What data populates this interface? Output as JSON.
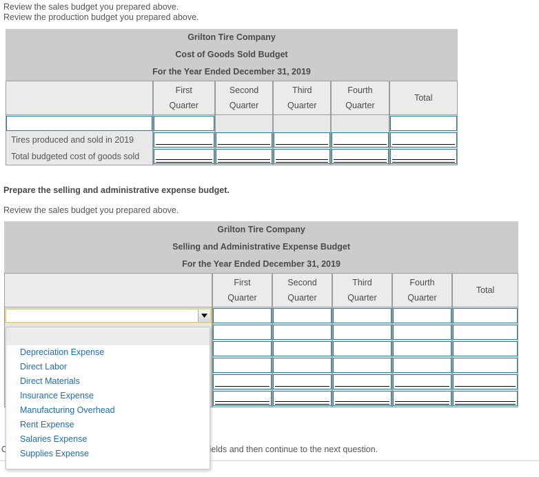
{
  "instructions": {
    "line1": "Review the sales budget you prepared above.",
    "line2": "Review the production budget you prepared above.",
    "line3": "Prepare the selling and administrative expense budget.",
    "line4": "Review the sales budget you prepared above.",
    "footer": "Choose from any list or enter any number in the input fields and then continue to the next question."
  },
  "colors": {
    "title_band": "#cccccc",
    "column_header": "#ebebeb",
    "cell_background": "#e8e8e8",
    "input_cell_background": "#ddeef6",
    "input_border": "#2a7a93",
    "select_border": "#e8d271",
    "option_text": "#1f6cb0"
  },
  "table_cogs": {
    "title_line1": "Grilton Tire Company",
    "title_line2": "Cost of Goods Sold Budget",
    "title_line3": "For the Year Ended December 31, 2019",
    "columns": [
      {
        "top": "",
        "bottom": ""
      },
      {
        "top": "First",
        "bottom": "Quarter"
      },
      {
        "top": "Second",
        "bottom": "Quarter"
      },
      {
        "top": "Third",
        "bottom": "Quarter"
      },
      {
        "top": "Fourth",
        "bottom": "Quarter"
      },
      {
        "top": "",
        "bottom": "Total"
      }
    ],
    "rows": [
      {
        "label": "",
        "label_is_input": true,
        "label_value": "",
        "cells": [
          {
            "type": "input",
            "value": "",
            "rule": "none"
          },
          {
            "type": "empty",
            "value": "",
            "rule": "none"
          },
          {
            "type": "empty",
            "value": "",
            "rule": "none"
          },
          {
            "type": "empty",
            "value": "",
            "rule": "none"
          },
          {
            "type": "input",
            "value": "",
            "rule": "none"
          }
        ]
      },
      {
        "label": "Tires produced and sold in 2019",
        "label_is_input": false,
        "label_value": "",
        "cells": [
          {
            "type": "input",
            "value": "",
            "rule": "single"
          },
          {
            "type": "input",
            "value": "",
            "rule": "single"
          },
          {
            "type": "input",
            "value": "",
            "rule": "single"
          },
          {
            "type": "input",
            "value": "",
            "rule": "single"
          },
          {
            "type": "input",
            "value": "",
            "rule": "single"
          }
        ]
      },
      {
        "label": "Total budgeted cost of goods sold",
        "label_is_input": false,
        "label_value": "",
        "cells": [
          {
            "type": "input",
            "value": "",
            "rule": "double"
          },
          {
            "type": "input",
            "value": "",
            "rule": "double"
          },
          {
            "type": "input",
            "value": "",
            "rule": "double"
          },
          {
            "type": "input",
            "value": "",
            "rule": "double"
          },
          {
            "type": "input",
            "value": "",
            "rule": "double"
          }
        ]
      }
    ]
  },
  "table_sae": {
    "title_line1": "Grilton Tire Company",
    "title_line2": "Selling and Administrative Expense Budget",
    "title_line3": "For the Year Ended December 31, 2019",
    "columns": [
      {
        "top": "",
        "bottom": ""
      },
      {
        "top": "First",
        "bottom": "Quarter"
      },
      {
        "top": "Second",
        "bottom": "Quarter"
      },
      {
        "top": "Third",
        "bottom": "Quarter"
      },
      {
        "top": "Fourth",
        "bottom": "Quarter"
      },
      {
        "top": "",
        "bottom": "Total"
      }
    ],
    "rows": [
      {
        "label": "",
        "label_is_select": true,
        "select_value": "",
        "cells": [
          {
            "type": "input",
            "value": "",
            "rule": "none"
          },
          {
            "type": "input",
            "value": "",
            "rule": "none"
          },
          {
            "type": "input",
            "value": "",
            "rule": "none"
          },
          {
            "type": "input",
            "value": "",
            "rule": "none"
          },
          {
            "type": "input",
            "value": "",
            "rule": "none"
          }
        ]
      },
      {
        "label": "",
        "label_is_select": false,
        "cells": [
          {
            "type": "input",
            "value": "",
            "rule": "none"
          },
          {
            "type": "input",
            "value": "",
            "rule": "none"
          },
          {
            "type": "input",
            "value": "",
            "rule": "none"
          },
          {
            "type": "input",
            "value": "",
            "rule": "none"
          },
          {
            "type": "input",
            "value": "",
            "rule": "none"
          }
        ]
      },
      {
        "label": "",
        "label_is_select": false,
        "cells": [
          {
            "type": "input",
            "value": "",
            "rule": "none"
          },
          {
            "type": "input",
            "value": "",
            "rule": "none"
          },
          {
            "type": "input",
            "value": "",
            "rule": "none"
          },
          {
            "type": "input",
            "value": "",
            "rule": "none"
          },
          {
            "type": "input",
            "value": "",
            "rule": "none"
          }
        ]
      },
      {
        "label": "",
        "label_is_select": false,
        "cells": [
          {
            "type": "input",
            "value": "",
            "rule": "none"
          },
          {
            "type": "input",
            "value": "",
            "rule": "none"
          },
          {
            "type": "input",
            "value": "",
            "rule": "none"
          },
          {
            "type": "input",
            "value": "",
            "rule": "none"
          },
          {
            "type": "input",
            "value": "",
            "rule": "none"
          }
        ]
      },
      {
        "label": "",
        "label_is_select": false,
        "cells": [
          {
            "type": "input",
            "value": "",
            "rule": "single"
          },
          {
            "type": "input",
            "value": "",
            "rule": "single"
          },
          {
            "type": "input",
            "value": "",
            "rule": "single"
          },
          {
            "type": "input",
            "value": "",
            "rule": "single"
          },
          {
            "type": "input",
            "value": "",
            "rule": "single"
          }
        ]
      },
      {
        "label": "",
        "label_is_select": false,
        "cells": [
          {
            "type": "input",
            "value": "",
            "rule": "double"
          },
          {
            "type": "input",
            "value": "",
            "rule": "double"
          },
          {
            "type": "input",
            "value": "",
            "rule": "double"
          },
          {
            "type": "input",
            "value": "",
            "rule": "double"
          },
          {
            "type": "input",
            "value": "",
            "rule": "double"
          }
        ]
      }
    ]
  },
  "dropdown": {
    "open": true,
    "selected": "",
    "options": [
      "",
      "Depreciation Expense",
      "Direct Labor",
      "Direct Materials",
      "Insurance Expense",
      "Manufacturing Overhead",
      "Rent Expense",
      "Salaries Expense",
      "Supplies Expense"
    ]
  }
}
